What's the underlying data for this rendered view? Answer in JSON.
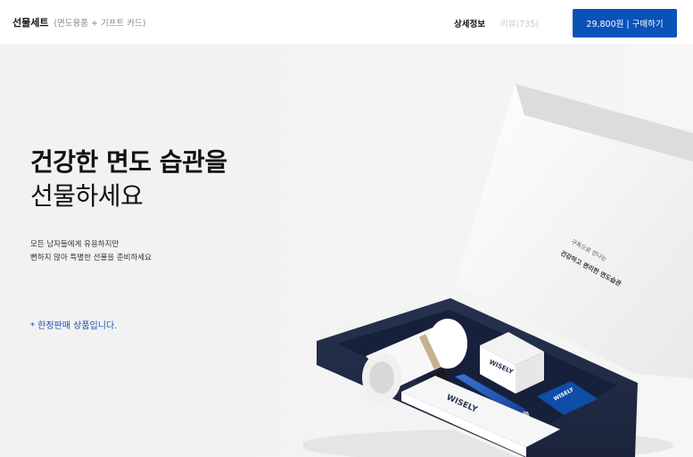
{
  "header": {
    "product_name": "선물세트",
    "product_sub": "(면도용품 + 기프트 카드)",
    "tab_detail": "상세정보",
    "tab_review": "리뷰(735)",
    "buy_button": "29,800원 | 구매하기"
  },
  "hero": {
    "headline_line1": "건강한 면도 습관을",
    "headline_line2": "선물하세요",
    "desc_line1": "모든 남자들에게 유용하지만",
    "desc_line2": "뻔하지 않아 특별한 선물을 준비하세요",
    "limited_note": "* 한정판매 상품입니다."
  },
  "box": {
    "lid_text_line1": "구독으로 만나는",
    "lid_text_line2": "건강하고 편리한 면도습관",
    "brand": "WISELY"
  },
  "colors": {
    "accent": "#0a52b8",
    "box_navy": "#1f2b4a",
    "limited_text": "#1a4fb5"
  }
}
